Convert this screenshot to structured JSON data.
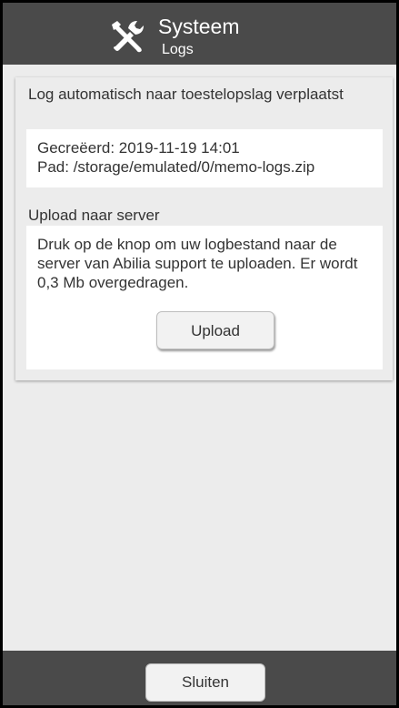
{
  "header": {
    "icon": "tools-icon",
    "title": "Systeem",
    "subtitle": "Logs"
  },
  "log_section": {
    "label": "Log automatisch naar toestelopslag verplaatst",
    "created": "Gecreëerd: 2019-11-19 14:01",
    "path": "Pad: /storage/emulated/0/memo-logs.zip"
  },
  "upload_section": {
    "label": "Upload naar server",
    "description": "Druk op de knop om uw logbestand naar de server van Abilia support te uploaden. Er wordt 0,3 Mb overgedragen.",
    "button_label": "Upload"
  },
  "footer": {
    "close_label": "Sluiten"
  },
  "colors": {
    "header_bg": "#4a4a4a",
    "background": "#ececec",
    "button_bg": "#f2f2f2"
  }
}
